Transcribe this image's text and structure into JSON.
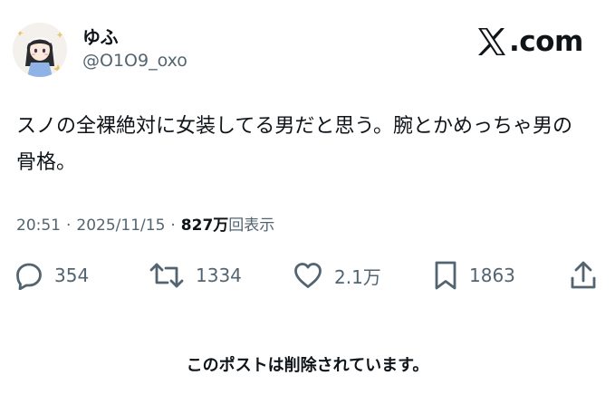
{
  "header": {
    "display_name": "ゆふ",
    "handle": "@O1O9_oxo",
    "brand": ".com"
  },
  "tweet": {
    "text": "スノの全裸絶対に女装してる男だと思う。腕とかめっちゃ男の\n骨格。",
    "time": "20:51",
    "separator": "·",
    "date": "2025/11/15",
    "views_count": "827万",
    "views_label": "回表示"
  },
  "actions": {
    "replies": {
      "icon": "reply-icon",
      "count": "354"
    },
    "retweets": {
      "icon": "retweet-icon",
      "count": "1334"
    },
    "likes": {
      "icon": "heart-icon",
      "count": "2.1万"
    },
    "bookmarks": {
      "icon": "bookmark-icon",
      "count": "1863"
    },
    "share": {
      "icon": "share-icon"
    }
  },
  "notice": {
    "deleted": "このポストは削除されています。"
  },
  "colors": {
    "text_primary": "#0f1419",
    "text_secondary": "#536471",
    "background": "#ffffff"
  }
}
